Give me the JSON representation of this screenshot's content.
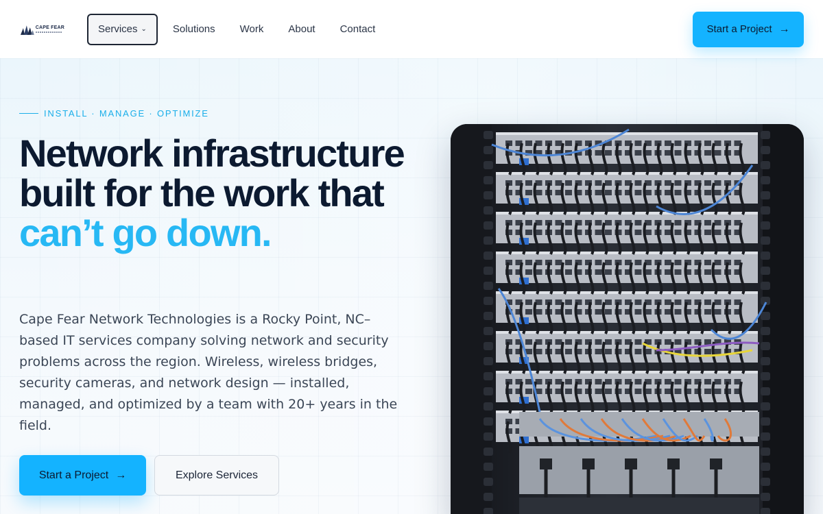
{
  "brand": {
    "logo_text": "CAPE FEAR",
    "logo_icon": "building-skyline-icon"
  },
  "nav": {
    "items": [
      {
        "label": "Services",
        "active": true,
        "has_dropdown": true
      },
      {
        "label": "Solutions",
        "active": false
      },
      {
        "label": "Work",
        "active": false
      },
      {
        "label": "About",
        "active": false
      },
      {
        "label": "Contact",
        "active": false
      }
    ],
    "cta_label": "Start a Project",
    "cta_icon": "arrow-right-icon"
  },
  "hero": {
    "eyebrow": "INSTALL · MANAGE · OPTIMIZE",
    "headline_part1": "Network infrastructure built for the work that ",
    "headline_accent": "can’t go down.",
    "lede": "Cape Fear Network Technologies is a Rocky Point, NC–based IT services company solving network and security problems across the region. Wireless, wireless bridges, security cameras, and network design — installed, managed, and optimized by a team with 20+ years in the field.",
    "primary_cta": "Start a Project",
    "secondary_cta": "Explore Services"
  },
  "colors": {
    "accent": "#14b3ff",
    "accent_text": "#27b8f4",
    "heading": "#0c1a30",
    "body_text": "#3b4656",
    "hero_bg": "#ebf6fc"
  },
  "arrow_glyph": "→",
  "chevron_glyph": "⌄"
}
